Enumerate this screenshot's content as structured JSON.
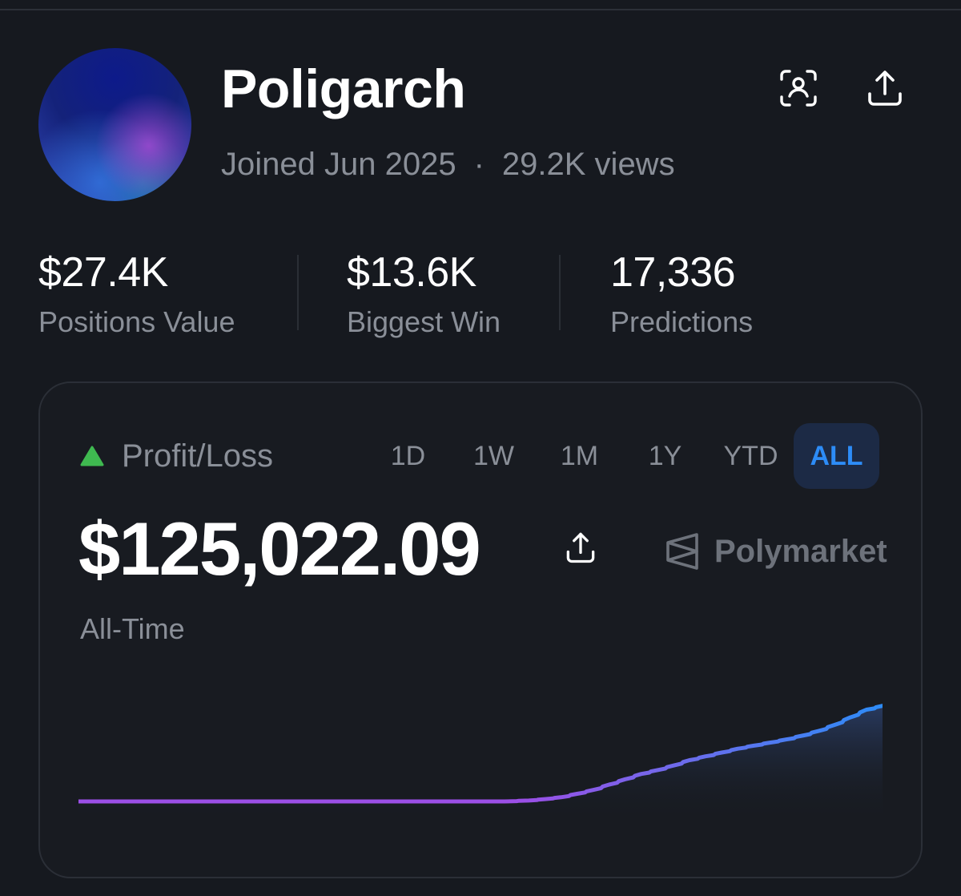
{
  "profile": {
    "name": "Poligarch",
    "joined": "Joined Jun 2025",
    "separator": "·",
    "views": "29.2K views"
  },
  "header_icons": [
    "qr-scan-icon",
    "share-icon"
  ],
  "stats": [
    {
      "value": "$27.4K",
      "label": "Positions Value"
    },
    {
      "value": "$13.6K",
      "label": "Biggest Win"
    },
    {
      "value": "17,336",
      "label": "Predictions"
    }
  ],
  "pnl": {
    "title": "Profit/Loss",
    "indicator_color": "#3fb950",
    "ranges": [
      "1D",
      "1W",
      "1M",
      "1Y",
      "YTD",
      "ALL"
    ],
    "active_range": "ALL",
    "value": "$125,022.09",
    "period": "All-Time",
    "brand": "Polymarket"
  },
  "colors": {
    "background": "#16191f",
    "accent_blue": "#2d8cf7",
    "line_purple": "#9b4fe6",
    "muted_text": "#8a8f98"
  },
  "chart_data": {
    "type": "line",
    "x": [
      0,
      0.1,
      0.2,
      0.3,
      0.4,
      0.45,
      0.5,
      0.53,
      0.56,
      0.58,
      0.6,
      0.62,
      0.64,
      0.66,
      0.68,
      0.7,
      0.72,
      0.74,
      0.76,
      0.78,
      0.8,
      0.82,
      0.84,
      0.86,
      0.88,
      0.9,
      0.92,
      0.94,
      0.96,
      0.98,
      1.0
    ],
    "values": [
      0,
      0,
      0,
      0,
      0,
      0,
      0,
      0,
      1200,
      3000,
      5500,
      10000,
      15000,
      22000,
      29000,
      36000,
      41000,
      47000,
      54000,
      59000,
      64000,
      69000,
      73000,
      77000,
      81000,
      86000,
      92000,
      100000,
      110000,
      120000,
      125022
    ],
    "ylim": [
      0,
      130000
    ],
    "grid": false,
    "xlabel": "",
    "ylabel": ""
  }
}
